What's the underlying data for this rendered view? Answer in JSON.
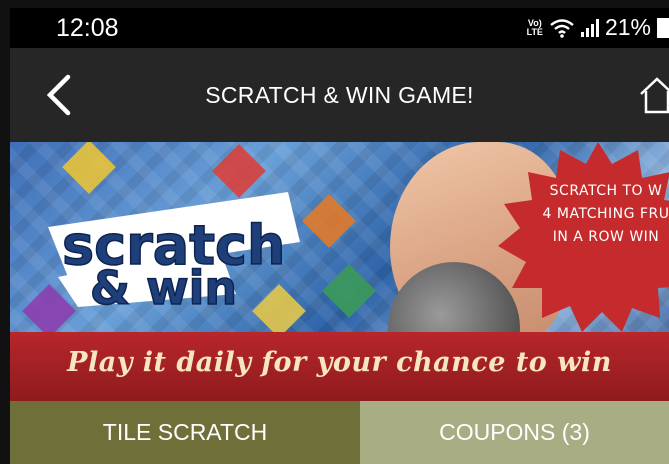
{
  "status_bar": {
    "time": "12:08",
    "network_label_top": "Vo)",
    "network_label_bottom": "LTE",
    "battery_text": "21%",
    "icons": [
      "volte-icon",
      "wifi-icon",
      "signal-icon",
      "battery-icon"
    ]
  },
  "app_bar": {
    "title": "SCRATCH & WIN GAME!",
    "back_icon": "chevron-left-icon",
    "home_icon": "home-icon"
  },
  "banner": {
    "logo_line1": "scratch",
    "logo_line2": "& win",
    "burst_lines": [
      "SCRATCH TO W",
      "4 MATCHING FRU",
      "IN A ROW WIN"
    ],
    "ribbon_text": "Play it daily for your chance to win"
  },
  "tabs": [
    {
      "label": "TILE SCRATCH",
      "active": true
    },
    {
      "label": "COUPONS (3)",
      "active": false
    }
  ],
  "colors": {
    "status_bar_bg": "#000000",
    "app_bar_bg": "#262626",
    "tab_active_bg": "#6f6f3a",
    "tab_inactive_bg": "#a9ad83",
    "ribbon_bg": "#b8262a"
  }
}
